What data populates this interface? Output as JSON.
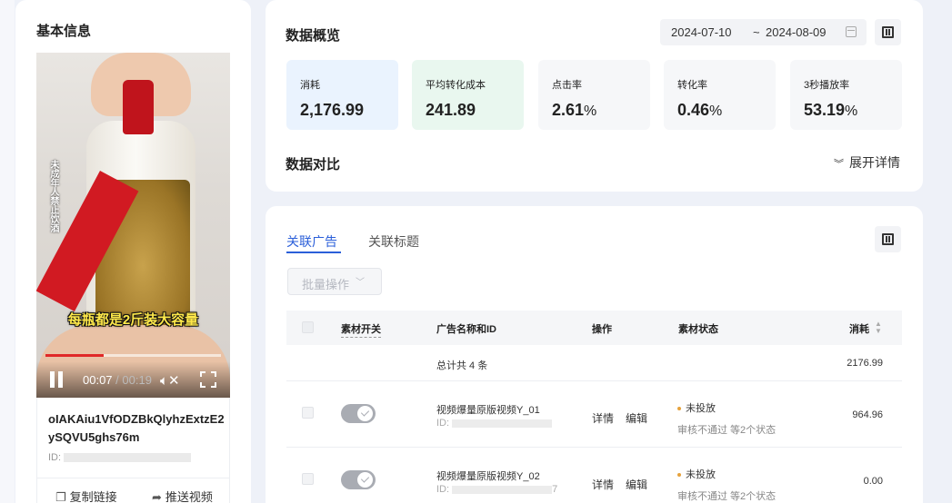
{
  "basic_info": {
    "title": "基本信息",
    "video": {
      "side_text": "未成年人禁止饮酒",
      "caption": "每瓶都是2斤装大容量",
      "time_current": "00:07",
      "time_separator": " / ",
      "time_total": "00:19",
      "progress": 0.33
    },
    "video_name": "oIAKAiu1VfODZBkQlyhzExtzE2ySQVU5ghs76m",
    "id_label": "ID:",
    "actions": {
      "copy_link": "复制链接",
      "push_video": "推送视频"
    }
  },
  "overview": {
    "title": "数据概览",
    "date_start": "2024-07-10",
    "date_sep": "~",
    "date_end": "2024-08-09",
    "metrics": [
      {
        "label": "消耗",
        "value": "2,176.99",
        "unit": "",
        "bg": "#eaf3fe"
      },
      {
        "label": "平均转化成本",
        "value": "241.89",
        "unit": "",
        "bg": "#e9f7ef"
      },
      {
        "label": "点击率",
        "value": "2.61",
        "unit": "%",
        "bg": "#f6f7f9"
      },
      {
        "label": "转化率",
        "value": "0.46",
        "unit": "%",
        "bg": "#f6f7f9"
      },
      {
        "label": "3秒播放率",
        "value": "53.19",
        "unit": "%",
        "bg": "#f6f7f9"
      }
    ],
    "compare_title": "数据对比",
    "expand_label": "展开详情"
  },
  "ads": {
    "tabs": [
      "关联广告",
      "关联标题"
    ],
    "batch_label": "批量操作",
    "columns": {
      "switch": "素材开关",
      "name": "广告名称和ID",
      "op": "操作",
      "status": "素材状态",
      "cost": "消耗"
    },
    "total_label": "总计共 4 条",
    "total_cost": "2176.99",
    "rows": [
      {
        "name": "视频爆量原版视频Y_01",
        "id_prefix": "ID: ",
        "id_tail": "",
        "detail": "详情",
        "edit": "编辑",
        "status": "未投放",
        "status_sub": "审核不通过 等2个状态",
        "cost": "964.96"
      },
      {
        "name": "视频爆量原版视频Y_02",
        "id_prefix": "ID: ",
        "id_tail": "7",
        "detail": "详情",
        "edit": "编辑",
        "status": "未投放",
        "status_sub": "审核不通过 等2个状态",
        "cost": "0.00"
      }
    ]
  }
}
